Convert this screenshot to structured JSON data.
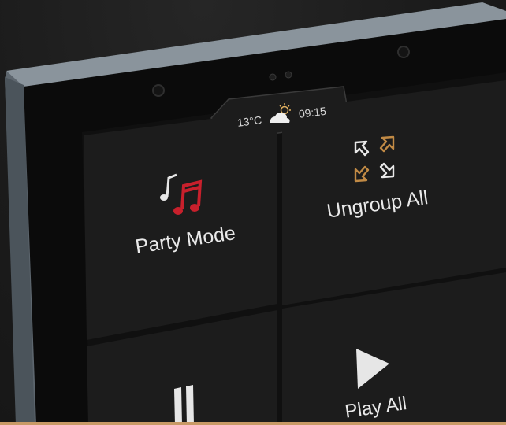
{
  "status_bar": {
    "temperature": "13°C",
    "time": "09:15",
    "weather_icon": "partly-cloudy-icon"
  },
  "tiles": [
    {
      "id": "party_mode",
      "label": "Party Mode",
      "icon": "music-notes-icon",
      "icon_color": "#c8202c"
    },
    {
      "id": "ungroup_all",
      "label": "Ungroup All",
      "icon": "ungroup-arrows-icon",
      "icon_color": "#c18a45"
    },
    {
      "id": "pause_all",
      "label": "",
      "icon": "pause-icon"
    },
    {
      "id": "play_all",
      "label": "Play All",
      "icon": "play-icon"
    }
  ],
  "colors": {
    "frame": "#6f7a83",
    "screen": "#0f0f0f",
    "tile": "#1c1c1c",
    "accent_red": "#c8202c",
    "accent_gold": "#c18a45",
    "bottom_strip": "#c99a66"
  }
}
